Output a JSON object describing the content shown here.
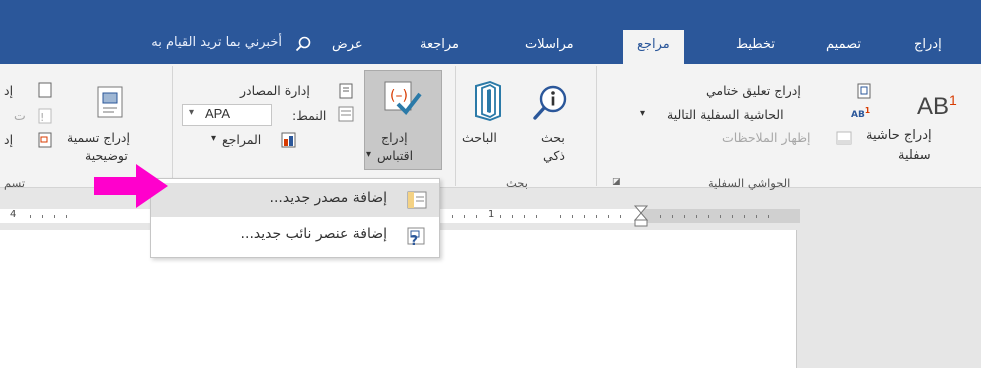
{
  "tabs": [
    {
      "label": "إدراج"
    },
    {
      "label": "تصميم"
    },
    {
      "label": "تخطيط"
    },
    {
      "label": "مراجع"
    },
    {
      "label": "مراسلات"
    },
    {
      "label": "مراجعة"
    },
    {
      "label": "عرض"
    }
  ],
  "active_tab": "مراجع",
  "tellme_placeholder": "أخبرني بما تريد القيام به",
  "ribbon": {
    "footnotes": {
      "insert_footnote": "إدراج حاشية",
      "insert_footnote_2": "سفلية",
      "insert_endnote": "إدراج تعليق ختامي",
      "next_footnote": "الحاشية السفلية التالية",
      "show_notes": "إظهار الملاحظات",
      "group_label": "الحواشي السفلية",
      "ab_glyph": "AB",
      "ab_sup": "1"
    },
    "research": {
      "smart_lookup": "بحث",
      "smart_lookup_2": "ذكي",
      "researcher": "الباحث",
      "group_label": "بحث"
    },
    "citations": {
      "insert_citation": "إدراج",
      "insert_citation_2": "اقتباس",
      "manage_sources": "إدارة المصادر",
      "style_label": "النمط:",
      "style_value": "APA",
      "bibliography": "المراجع"
    },
    "captions": {
      "insert_caption": "إدراج تسمية",
      "insert_caption_2": "توضيحية",
      "group_label": "تسم",
      "cut_item_1": "إد",
      "cut_item_2": "ت",
      "cut_item_3": "إد"
    }
  },
  "ruler": {
    "left_number": "4",
    "center_number": "1"
  },
  "menu": {
    "items": [
      {
        "label": "إضافة مصدر جديد...",
        "highlighted": true
      },
      {
        "label": "إضافة عنصر نائب جديد...",
        "highlighted": false
      }
    ]
  },
  "colors": {
    "accent": "#2b579a",
    "arrow": "#ff00cc",
    "ribbon_bg": "#f3f3f3"
  }
}
